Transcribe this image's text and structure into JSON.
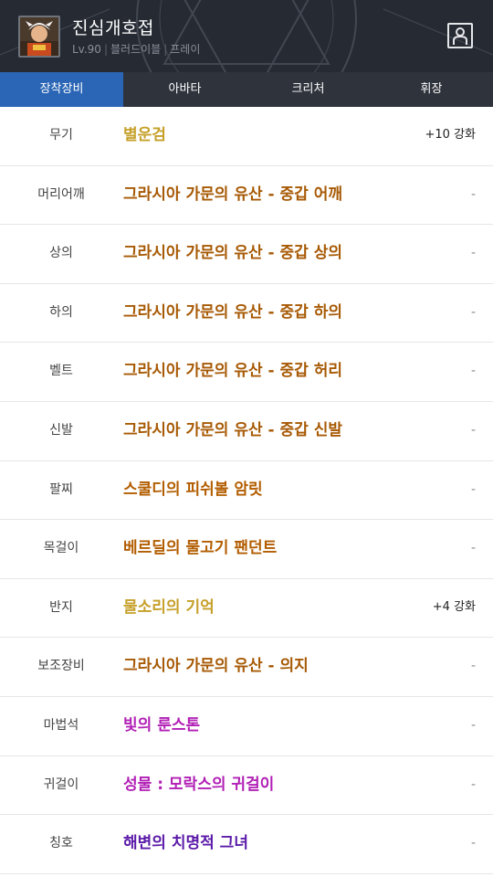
{
  "character": {
    "name": "진심개호접",
    "level": "Lv.90",
    "class": "블러드이블",
    "server": "프레이"
  },
  "tabs": [
    {
      "label": "장착장비",
      "active": true
    },
    {
      "label": "아바타",
      "active": false
    },
    {
      "label": "크리처",
      "active": false
    },
    {
      "label": "휘장",
      "active": false
    }
  ],
  "colors": {
    "unique": "#c6a02a",
    "epic": "#b25d00",
    "legendary_set": "#a75a05",
    "rare": "#b11fb5",
    "title": "#5b1aa8",
    "tab_active": "#2a66b5",
    "header_bg": "#262a33"
  },
  "equipment": [
    {
      "slot": "무기",
      "item": "별운검",
      "color": "#c6a02a",
      "enhance": "+10 강화"
    },
    {
      "slot": "머리어깨",
      "item": "그라시아 가문의 유산 - 중갑 어깨",
      "color": "#a75a05",
      "enhance": "-"
    },
    {
      "slot": "상의",
      "item": "그라시아 가문의 유산 - 중갑 상의",
      "color": "#a75a05",
      "enhance": "-"
    },
    {
      "slot": "하의",
      "item": "그라시아 가문의 유산 - 중갑 하의",
      "color": "#a75a05",
      "enhance": "-"
    },
    {
      "slot": "벨트",
      "item": "그라시아 가문의 유산 - 중갑 허리",
      "color": "#a75a05",
      "enhance": "-"
    },
    {
      "slot": "신발",
      "item": "그라시아 가문의 유산 - 중갑 신발",
      "color": "#a75a05",
      "enhance": "-"
    },
    {
      "slot": "팔찌",
      "item": "스쿨디의 피쉬볼 암릿",
      "color": "#b25d00",
      "enhance": "-"
    },
    {
      "slot": "목걸이",
      "item": "베르딜의 물고기 팬던트",
      "color": "#b25d00",
      "enhance": "-"
    },
    {
      "slot": "반지",
      "item": "물소리의 기억",
      "color": "#c6a02a",
      "enhance": "+4 강화"
    },
    {
      "slot": "보조장비",
      "item": "그라시아 가문의 유산 - 의지",
      "color": "#a75a05",
      "enhance": "-"
    },
    {
      "slot": "마법석",
      "item": "빛의 룬스톤",
      "color": "#b11fb5",
      "enhance": "-"
    },
    {
      "slot": "귀걸이",
      "item": "성물 : 모락스의 귀걸이",
      "color": "#b11fb5",
      "enhance": "-"
    },
    {
      "slot": "칭호",
      "item": "해변의 치명적 그녀",
      "color": "#5b1aa8",
      "enhance": "-"
    }
  ]
}
